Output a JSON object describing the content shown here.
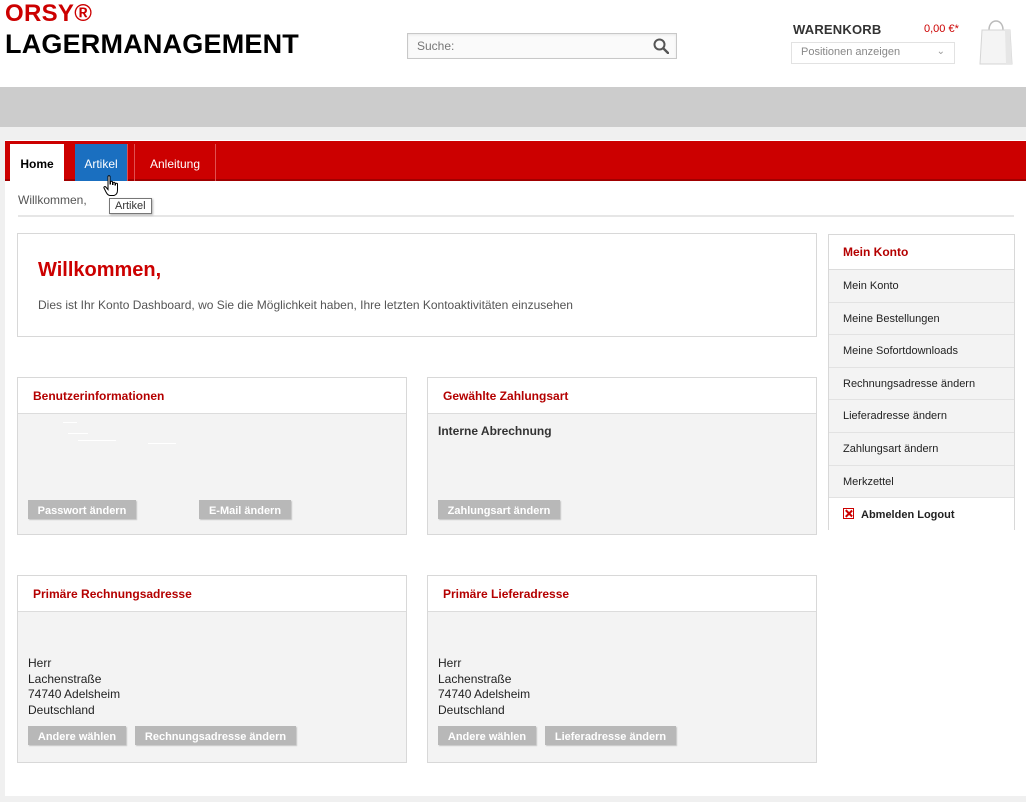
{
  "header": {
    "logo_line1": "ORSY®",
    "logo_line2": "LAGERMANAGEMENT",
    "search_placeholder": "Suche:",
    "cart_title": "WARENKORB",
    "cart_total": "0,00 €*",
    "cart_select": "Positionen anzeigen"
  },
  "nav": {
    "tabs": [
      {
        "label": "Home"
      },
      {
        "label": "Artikel"
      },
      {
        "label": "Anleitung"
      }
    ],
    "tooltip": "Artikel"
  },
  "breadcrumb": "Willkommen,",
  "welcome": {
    "title": "Willkommen,",
    "text": "Dies ist Ihr Konto Dashboard, wo Sie die Möglichkeit haben, Ihre letzten Kontoaktivitäten einzusehen"
  },
  "panels": {
    "benutzer": {
      "title": "Benutzerinformationen",
      "btn_password": "Passwort ändern",
      "btn_email": "E-Mail ändern"
    },
    "zahlung": {
      "title": "Gewählte Zahlungsart",
      "value": "Interne Abrechnung",
      "btn": "Zahlungsart ändern"
    },
    "rechnung": {
      "title": "Primäre Rechnungsadresse",
      "lines": [
        "Herr",
        "Lachenstraße",
        "74740 Adelsheim",
        "Deutschland"
      ],
      "btn_choose": "Andere wählen",
      "btn_change": "Rechnungsadresse ändern"
    },
    "liefer": {
      "title": "Primäre Lieferadresse",
      "lines": [
        "Herr",
        "Lachenstraße",
        "74740 Adelsheim",
        "Deutschland"
      ],
      "btn_choose": "Andere wählen",
      "btn_change": "Lieferadresse ändern"
    }
  },
  "sidebar": {
    "title": "Mein Konto",
    "items": [
      "Mein Konto",
      "Meine Bestellungen",
      "Meine Sofortdownloads",
      "Rechnungsadresse ändern",
      "Lieferadresse ändern",
      "Zahlungsart ändern",
      "Merkzettel"
    ],
    "logout": "Abmelden Logout"
  },
  "colors": {
    "brand_red": "#cc0000",
    "active_tab_blue": "#1a6fc0",
    "button_gray": "#b8b8b8"
  }
}
